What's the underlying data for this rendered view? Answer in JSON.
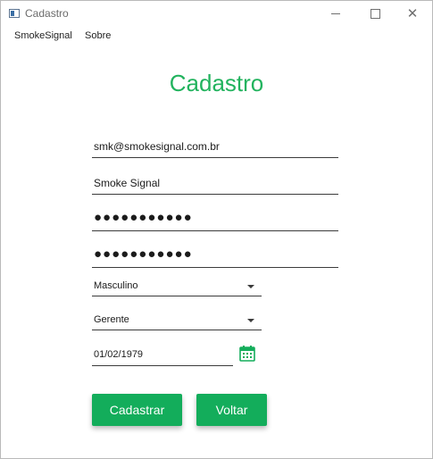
{
  "window": {
    "title": "Cadastro",
    "controls": {
      "minimize_icon": "minimize-icon",
      "maximize_icon": "maximize-icon",
      "close_icon": "close-icon"
    }
  },
  "menu": {
    "items": [
      {
        "label": "SmokeSignal"
      },
      {
        "label": "Sobre"
      }
    ]
  },
  "form": {
    "heading": "Cadastro",
    "email": {
      "value": "smk@smokesignal.com.br"
    },
    "name": {
      "value": "Smoke Signal"
    },
    "password": {
      "value": "●●●●●●●●●●●"
    },
    "password_confirm": {
      "value": "●●●●●●●●●●●"
    },
    "gender": {
      "selected": "Masculino"
    },
    "role": {
      "selected": "Gerente"
    },
    "birth_date": {
      "value": "01/02/1979",
      "icon": "calendar-icon"
    },
    "buttons": {
      "submit": "Cadastrar",
      "back": "Voltar"
    }
  },
  "colors": {
    "accent": "#22b35e",
    "button_bg": "#13ad5b",
    "button_text": "#ffffff"
  }
}
